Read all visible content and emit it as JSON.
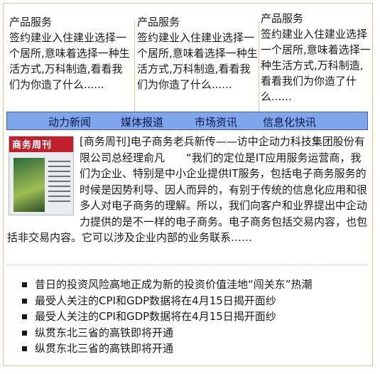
{
  "columns": [
    {
      "title": "产品服务",
      "body": "签约建业入住建业选择一个居所,意味着选择一种生活方式,万科制造,看看我们为你造了什么......"
    },
    {
      "title": "产品服务",
      "body": "签约建业入住建业选择一个居所,意味着选择一种生活方式,万科制造,看看我们为你造了什么......"
    },
    {
      "title": "产品服务",
      "body": "签约建业入住建业选择一个居所,意味着选择一种生活方式,万科制造,看看我们为你造了什么......"
    }
  ],
  "nav": [
    "动力新闻",
    "媒体报道",
    "市场资讯",
    "信息化快讯"
  ],
  "article": {
    "cover_masthead": "商务周刊",
    "text": "[商务周刊]电子商务老兵新传——访中企动力科技集团股份有限公司总经理俞凡　　“我们的定位是IT应用服务运营商，我们为企业、特别是中小企业提供IT服务，包括电子商务服务的时候是因势利导、因人而异的，有别于传统的信息化应用和很多人对电子商务的理解。所以，我们向客户和业界提出中企动力提供的是不一样的电子商务。电子商务包括交易内容，也包括非交易内容。它可以涉及企业内部的业务联系……"
  },
  "news": [
    "昔日的投资风险高地正成为新的投资价值洼地“闯关东”热潮",
    "最受人关注的CPI和GDP数据将在4月15日揭开面纱",
    "最受人关注的CPI和GDP数据将在4月15日揭开面纱",
    "纵贯东北三省的高铁即将开通",
    "纵贯东北三省的高铁即将开通"
  ],
  "colors": {
    "border": "#e8c48f",
    "nav_bg": "#7fa6ea",
    "nav_border": "#3b5cc4"
  }
}
